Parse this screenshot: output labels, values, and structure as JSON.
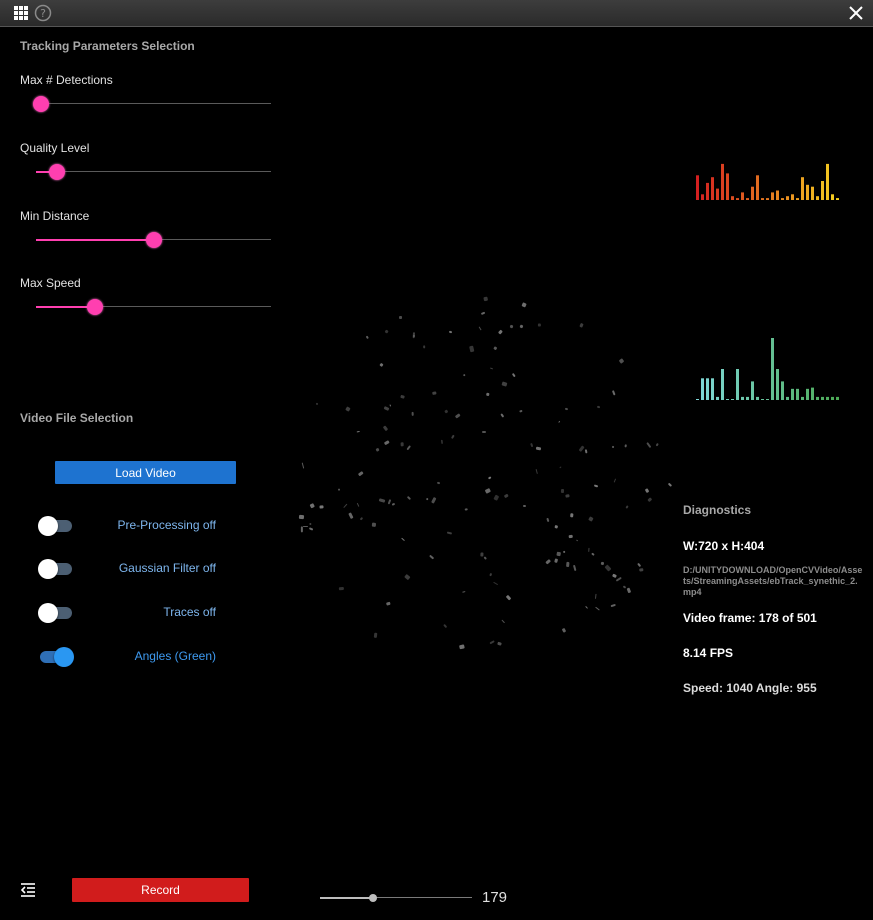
{
  "titlebar": {
    "apps_icon": "grid-icon",
    "help_icon": "help-circle-icon",
    "close_icon": "close-x-icon"
  },
  "tracking": {
    "title": "Tracking Parameters Selection",
    "sliders": [
      {
        "label": "Max # Detections",
        "value": 0.02
      },
      {
        "label": "Quality Level",
        "value": 0.09
      },
      {
        "label": "Min Distance",
        "value": 0.5
      },
      {
        "label": "Max Speed",
        "value": 0.25
      }
    ]
  },
  "video": {
    "title": "Video File Selection",
    "load_label": "Load Video",
    "toggles": [
      {
        "label": "Pre-Processing off",
        "on": false
      },
      {
        "label": "Gaussian Filter off",
        "on": false
      },
      {
        "label": "Traces off",
        "on": false
      },
      {
        "label": "Angles (Green)",
        "on": true
      }
    ]
  },
  "diagnostics": {
    "title": "Diagnostics",
    "resolution": "W:720 x H:404",
    "path": "D:/UNITYDOWNLOAD/OpenCVVideo/Assets/StreamingAssets/ebTrack_synethic_2.mp4",
    "frame": "Video frame: 178 of 501",
    "fps": "8.14 FPS",
    "speed_angle": "Speed: 1040 Angle: 955"
  },
  "bottom": {
    "menu_icon": "menu-collapse-icon",
    "record_label": "Record",
    "frame_value": "179",
    "frame_slider": 0.35
  },
  "histograms": {
    "speed": [
      0.65,
      0.15,
      0.45,
      0.6,
      0.3,
      0.95,
      0.7,
      0.1,
      0.05,
      0.2,
      0.05,
      0.35,
      0.65,
      0.05,
      0.05,
      0.2,
      0.25,
      0.05,
      0.1,
      0.15,
      0.05,
      0.6,
      0.4,
      0.35,
      0.1,
      0.5,
      0.95,
      0.15,
      0.05
    ],
    "angle": [
      0.0,
      0.35,
      0.35,
      0.35,
      0.05,
      0.5,
      0.0,
      0.0,
      0.5,
      0.05,
      0.05,
      0.3,
      0.05,
      0.0,
      0.0,
      1.0,
      0.5,
      0.3,
      0.05,
      0.18,
      0.18,
      0.05,
      0.18,
      0.2,
      0.05,
      0.05,
      0.05,
      0.05,
      0.05
    ],
    "colors": {
      "speed_low": "#d42020",
      "speed_high": "#f5d020",
      "angle_low": "#7fd8d8",
      "angle_high": "#4caa55"
    }
  },
  "colors": {
    "accent": "#ff3fb0",
    "button": "#1e73d0",
    "record": "#d11c1c",
    "toggle_on": "#2a97f2"
  }
}
